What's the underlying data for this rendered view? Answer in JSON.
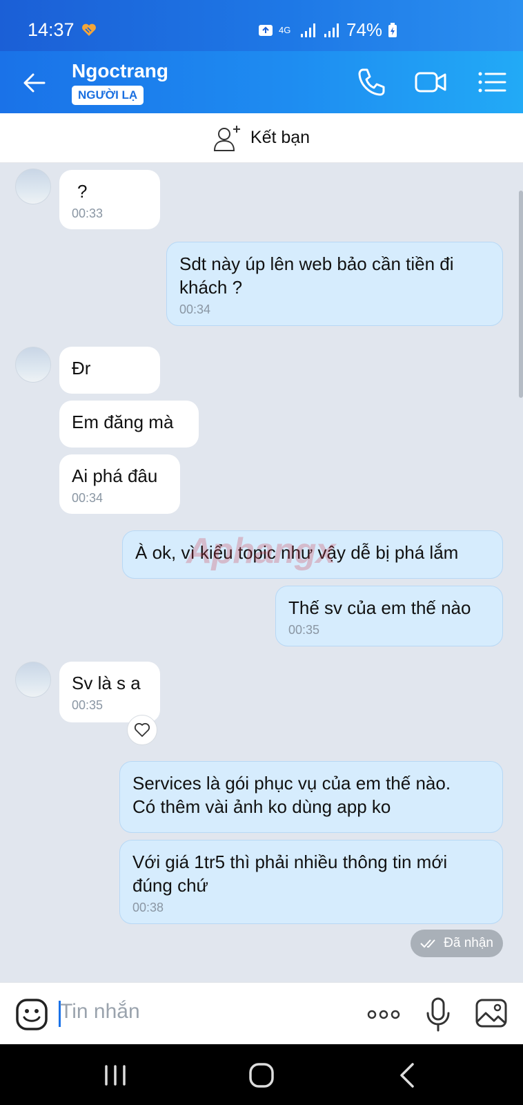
{
  "status": {
    "time": "14:37",
    "network": "4G",
    "battery": "74%"
  },
  "header": {
    "name": "Ngoctrang",
    "badge": "NGƯỜI LẠ"
  },
  "friend_bar": {
    "label": "Kết bạn"
  },
  "messages": [
    {
      "dir": "in",
      "text": "?",
      "time": "00:33"
    },
    {
      "dir": "out",
      "text_line1": "Sdt này úp lên web bảo cần tiền đi",
      "text_line2": "khách ?",
      "time": "00:34"
    },
    {
      "dir": "in",
      "text": "Đr"
    },
    {
      "dir": "in",
      "text": "Em đăng mà"
    },
    {
      "dir": "in",
      "text": "Ai phá đâu",
      "time": "00:34"
    },
    {
      "dir": "out",
      "text": "À ok, vì kiểu topic như vậy dễ bị phá lắm"
    },
    {
      "dir": "out",
      "text": "Thế sv của em thế nào",
      "time": "00:35"
    },
    {
      "dir": "in",
      "text": "Sv là s a",
      "time": "00:35"
    },
    {
      "dir": "out",
      "text_line1": "Services là gói phục vụ của em thế nào.",
      "text_line2": "Có thêm vài ảnh ko dùng app ko"
    },
    {
      "dir": "out",
      "text_line1": "Với giá 1tr5 thì phải nhiều thông tin mới",
      "text_line2": "đúng chứ",
      "time": "00:38"
    }
  ],
  "delivery_status": "Đã nhận",
  "watermark": "Aphangx",
  "composer": {
    "placeholder": "Tin nhắn"
  },
  "icons": {
    "back": "arrow-left-icon",
    "call": "phone-icon",
    "video": "video-camera-icon",
    "menu": "list-menu-icon",
    "add_friend": "add-user-icon",
    "reaction": "heart-icon",
    "emoji": "sticker-icon",
    "more": "more-dots-icon",
    "mic": "microphone-icon",
    "image": "image-icon"
  },
  "colors": {
    "header_gradient_start": "#1a72e8",
    "header_gradient_end": "#22aaf6",
    "outgoing_bubble": "#d6ecfd",
    "incoming_bubble": "#ffffff",
    "chat_background": "#e1e6ee"
  }
}
